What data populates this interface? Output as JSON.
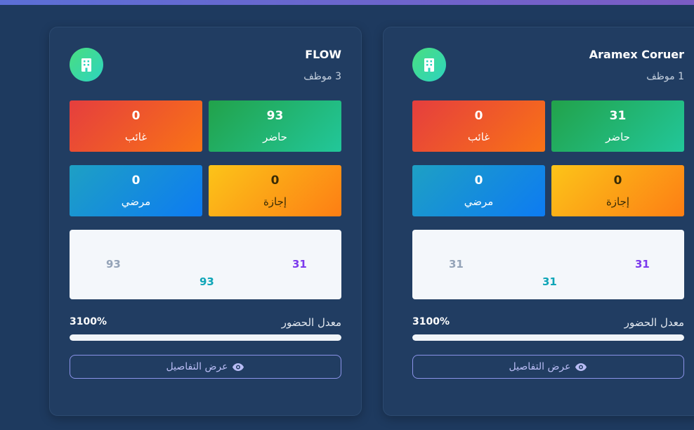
{
  "cards": [
    {
      "name": "Aramex Coruer",
      "employees": "1 موظف",
      "present": {
        "value": "31",
        "label": "حاضر"
      },
      "absent": {
        "value": "0",
        "label": "غائب"
      },
      "leave": {
        "value": "0",
        "label": "إجازة"
      },
      "sick": {
        "value": "0",
        "label": "مرضي"
      },
      "chart": {
        "values": [
          "31",
          "31",
          "31"
        ]
      },
      "rate_label": "معدل الحضور",
      "rate_value": "3100%",
      "rate_fill": 1.0,
      "details_label": "عرض التفاصيل",
      "icon": "building-icon"
    },
    {
      "name": "FLOW",
      "employees": "3 موظف",
      "present": {
        "value": "93",
        "label": "حاضر"
      },
      "absent": {
        "value": "0",
        "label": "غائب"
      },
      "leave": {
        "value": "0",
        "label": "إجازة"
      },
      "sick": {
        "value": "0",
        "label": "مرضي"
      },
      "chart": {
        "values": [
          "31",
          "93",
          "93"
        ]
      },
      "rate_label": "معدل الحضور",
      "rate_value": "3100%",
      "rate_fill": 1.0,
      "details_label": "عرض التفاصيل",
      "icon": "building-icon"
    }
  ],
  "colors": {
    "background": "#1e3a5f",
    "present": "#22a24a",
    "absent": "#e53e3e",
    "leave": "#fcc419",
    "sick": "#0d7bf2",
    "accent": "#8b93e8"
  }
}
